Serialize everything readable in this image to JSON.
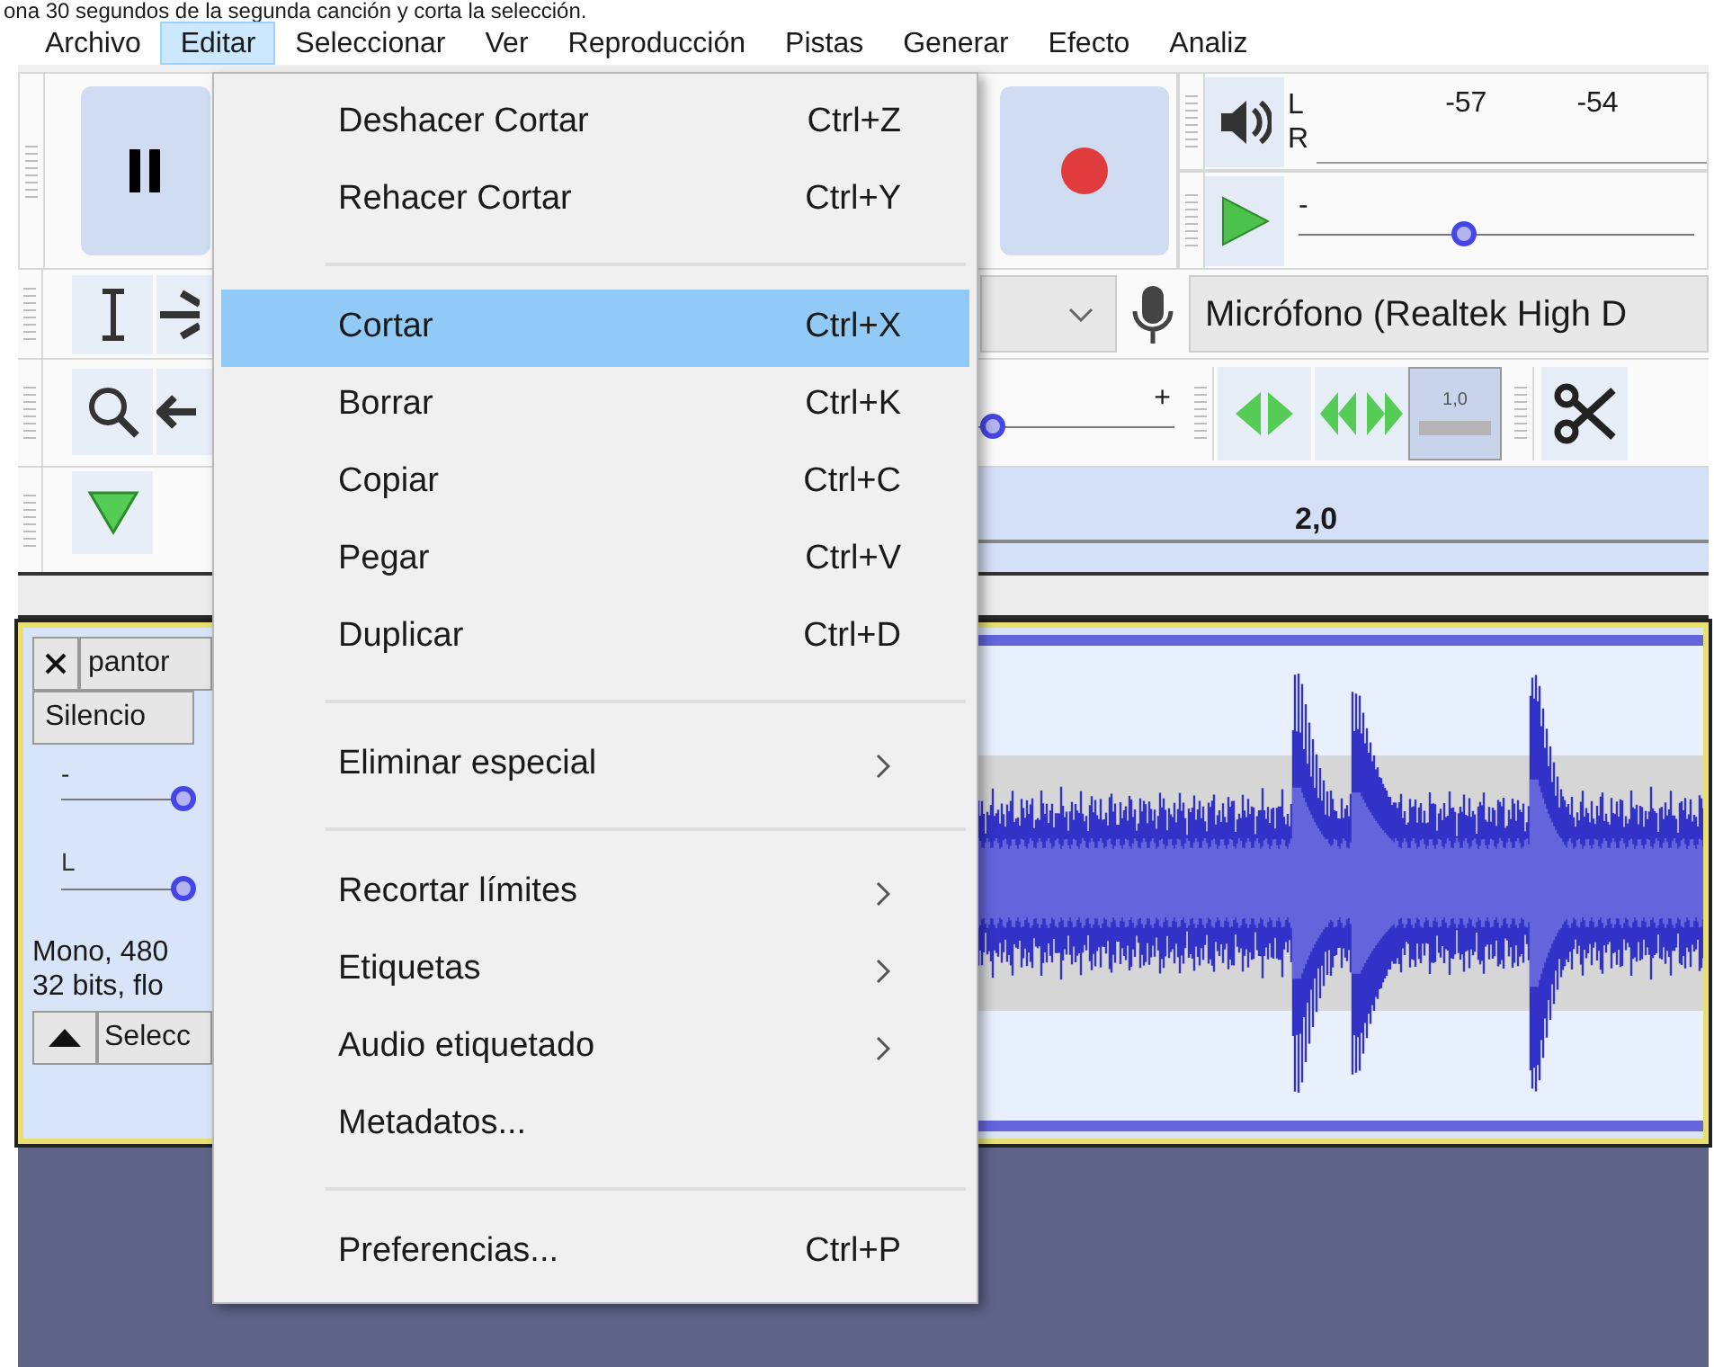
{
  "caption": "ona 30 segundos de la segunda canción y corta la selección.",
  "menu_bar": [
    {
      "label": "Archivo",
      "selected": false
    },
    {
      "label": "Editar",
      "selected": true
    },
    {
      "label": "Seleccionar",
      "selected": false
    },
    {
      "label": "Ver",
      "selected": false
    },
    {
      "label": "Reproducción",
      "selected": false
    },
    {
      "label": "Pistas",
      "selected": false
    },
    {
      "label": "Generar",
      "selected": false
    },
    {
      "label": "Efecto",
      "selected": false
    },
    {
      "label": "Analiz",
      "selected": false
    }
  ],
  "edit_menu": [
    {
      "kind": "item",
      "label": "Deshacer Cortar",
      "shortcut": "Ctrl+Z",
      "selected": false
    },
    {
      "kind": "item",
      "label": "Rehacer Cortar",
      "shortcut": "Ctrl+Y",
      "selected": false
    },
    {
      "kind": "separator"
    },
    {
      "kind": "item",
      "label": "Cortar",
      "shortcut": "Ctrl+X",
      "selected": true
    },
    {
      "kind": "item",
      "label": "Borrar",
      "shortcut": "Ctrl+K",
      "selected": false
    },
    {
      "kind": "item",
      "label": "Copiar",
      "shortcut": "Ctrl+C",
      "selected": false
    },
    {
      "kind": "item",
      "label": "Pegar",
      "shortcut": "Ctrl+V",
      "selected": false
    },
    {
      "kind": "item",
      "label": "Duplicar",
      "shortcut": "Ctrl+D",
      "selected": false
    },
    {
      "kind": "separator"
    },
    {
      "kind": "submenu",
      "label": "Eliminar especial",
      "selected": false
    },
    {
      "kind": "separator"
    },
    {
      "kind": "submenu",
      "label": "Recortar límites",
      "selected": false
    },
    {
      "kind": "submenu",
      "label": "Etiquetas",
      "selected": false
    },
    {
      "kind": "submenu",
      "label": "Audio etiquetado",
      "selected": false
    },
    {
      "kind": "item",
      "label": "Metadatos...",
      "selected": false
    },
    {
      "kind": "separator"
    },
    {
      "kind": "item",
      "label": "Preferencias...",
      "shortcut": "Ctrl+P",
      "selected": false
    }
  ],
  "meter": {
    "channels": [
      "L",
      "R"
    ],
    "scale": [
      "-57",
      "-54"
    ]
  },
  "playback_slider": {
    "label": "-",
    "level": 0.42
  },
  "input_device": "Micrófono (Realtek High D",
  "speed_slider": {
    "label": "+",
    "level": 0.08
  },
  "zoom_toggle": "1,0",
  "ruler": {
    "labels": [
      "2,0"
    ]
  },
  "track": {
    "name": "pantor",
    "mute_button": "Silencio",
    "gain": {
      "label": "-"
    },
    "pan": {
      "label": "L"
    },
    "info": [
      "Mono, 480",
      "32 bits, flo"
    ],
    "select_button": "Selecc"
  }
}
